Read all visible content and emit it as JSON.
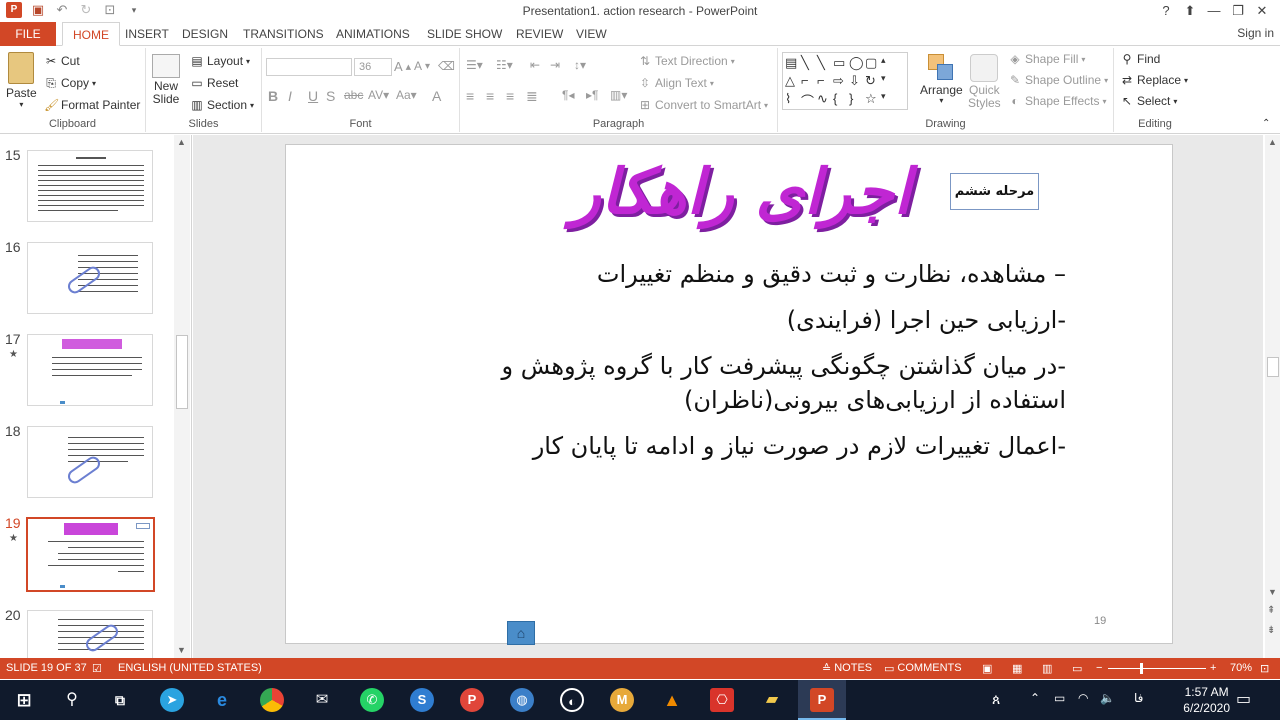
{
  "window": {
    "title": "Presentation1. action research - PowerPoint",
    "controls": [
      "?",
      "⬆",
      "—",
      "❐",
      "✕"
    ]
  },
  "tabs": [
    "FILE",
    "HOME",
    "INSERT",
    "DESIGN",
    "TRANSITIONS",
    "ANIMATIONS",
    "SLIDE SHOW",
    "REVIEW",
    "VIEW"
  ],
  "active_tab": "HOME",
  "signin": "Sign in",
  "ribbon": {
    "clipboard": {
      "paste": "Paste",
      "cut": "Cut",
      "copy": "Copy",
      "format_painter": "Format Painter",
      "label": "Clipboard"
    },
    "slides": {
      "new_slide": "New",
      "new_slide2": "Slide",
      "layout": "Layout",
      "reset": "Reset",
      "section": "Section",
      "label": "Slides"
    },
    "font": {
      "size": "36",
      "label": "Font"
    },
    "paragraph": {
      "text_direction": "Text Direction",
      "align_text": "Align Text",
      "convert_smartart": "Convert to SmartArt",
      "label": "Paragraph"
    },
    "drawing": {
      "arrange": "Arrange",
      "quick_styles": "Quick",
      "quick_styles2": "Styles",
      "shape_fill": "Shape Fill",
      "shape_outline": "Shape Outline",
      "shape_effects": "Shape Effects",
      "label": "Drawing"
    },
    "editing": {
      "find": "Find",
      "replace": "Replace",
      "select": "Select",
      "label": "Editing"
    }
  },
  "thumbnails": [
    {
      "num": "15",
      "star": false,
      "selected": false
    },
    {
      "num": "16",
      "star": false,
      "selected": false
    },
    {
      "num": "17",
      "star": true,
      "selected": false
    },
    {
      "num": "18",
      "star": false,
      "selected": false
    },
    {
      "num": "19",
      "star": true,
      "selected": true
    },
    {
      "num": "20",
      "star": false,
      "selected": false
    }
  ],
  "slide": {
    "title": "اجرای راهکار",
    "stage": "مرحله ششم",
    "bullets": [
      "– مشاهده، نظارت و ثبت دقیق و منظم تغییرات",
      "-ارزیابی حین اجرا (فرایندی)",
      "-در میان گذاشتن چگونگی پیشرفت کار با گروه پژوهش و استفاده از ارزیابی‌های بیرونی(ناظران)",
      "-اعمال تغییرات لازم در صورت نیاز و ادامه تا پایان کار"
    ],
    "number": "19"
  },
  "status": {
    "slide_info": "SLIDE 19 OF 37",
    "language": "ENGLISH (UNITED STATES)",
    "notes": "NOTES",
    "comments": "COMMENTS",
    "zoom": "70%"
  },
  "taskbar": {
    "lang": "فا",
    "time": "1:57 AM",
    "date": "6/2/2020"
  }
}
